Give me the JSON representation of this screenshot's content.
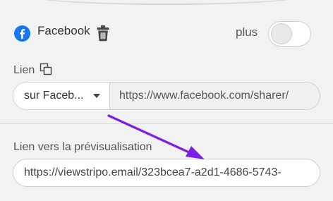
{
  "social": {
    "network_label": "Facebook",
    "network_icon": "facebook-icon",
    "delete_icon": "trash-icon",
    "plus_label": "plus",
    "plus_toggle_on": false
  },
  "link": {
    "label": "Lien",
    "copy_icon": "copy-icon",
    "select_value": "sur Faceb...",
    "url_value": "https://www.facebook.com/sharer/"
  },
  "preview": {
    "label": "Lien vers la prévisualisation",
    "url_value": "https://viewstripo.email/323bcea7-a2d1-4686-5743-"
  },
  "annotation": {
    "arrow_color": "#7b1fe6"
  },
  "colors": {
    "facebook_blue": "#1877f2",
    "background": "#f2f2f2"
  }
}
